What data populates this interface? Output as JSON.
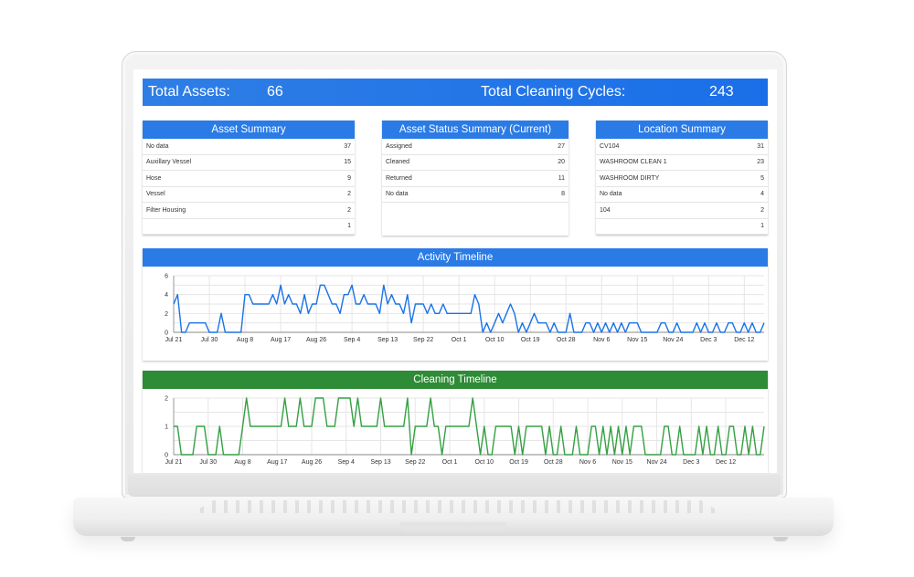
{
  "kpis": {
    "total_assets_label": "Total Assets:",
    "total_assets_value": "66",
    "total_cycles_label": "Total Cleaning Cycles:",
    "total_cycles_value": "243"
  },
  "panels": {
    "asset_summary": {
      "title": "Asset Summary",
      "rows": [
        {
          "label": "No data",
          "value": "37"
        },
        {
          "label": "Auxillary Vessel",
          "value": "15"
        },
        {
          "label": "Hose",
          "value": "9"
        },
        {
          "label": "Vessel",
          "value": "2"
        },
        {
          "label": "Filter Housing",
          "value": "2"
        },
        {
          "label": "",
          "value": "1"
        }
      ]
    },
    "asset_status_summary": {
      "title": "Asset Status Summary (Current)",
      "rows": [
        {
          "label": "Assigned",
          "value": "27"
        },
        {
          "label": "Cleaned",
          "value": "20"
        },
        {
          "label": "Returned",
          "value": "11"
        },
        {
          "label": "No data",
          "value": "8"
        }
      ]
    },
    "location_summary": {
      "title": "Location Summary",
      "rows": [
        {
          "label": "CV104",
          "value": "31"
        },
        {
          "label": "WASHROOM CLEAN 1",
          "value": "23"
        },
        {
          "label": "WASHROOM DIRTY",
          "value": "5"
        },
        {
          "label": "No data",
          "value": "4"
        },
        {
          "label": "104",
          "value": "2"
        },
        {
          "label": "",
          "value": "1"
        }
      ]
    }
  },
  "colors": {
    "header_blue": "#2b7be6",
    "header_green": "#2e8b36",
    "activity_line": "#1a73e8",
    "cleaning_line": "#34a043"
  },
  "chart_data": [
    {
      "type": "line",
      "title": "Activity Timeline",
      "xlabel": "",
      "ylabel": "",
      "x_start": "Jul 21",
      "x_step_days": 1,
      "tick_labels": [
        "Jul 21",
        "Jul 30",
        "Aug 8",
        "Aug 17",
        "Aug 26",
        "Sep 4",
        "Sep 13",
        "Sep 22",
        "Oct 1",
        "Oct 10",
        "Oct 19",
        "Oct 28",
        "Nov 6",
        "Nov 15",
        "Nov 24",
        "Dec 3",
        "Dec 12"
      ],
      "tick_every_days": 9,
      "y_ticks": [
        0,
        2,
        4,
        6
      ],
      "ylim": [
        0,
        6
      ],
      "grid": true,
      "legend": "none",
      "series": [
        {
          "name": "Activity",
          "values": [
            3,
            4,
            0,
            0,
            1,
            1,
            1,
            1,
            1,
            0,
            0,
            0,
            2,
            0,
            0,
            0,
            0,
            0,
            4,
            4,
            3,
            3,
            3,
            3,
            3,
            4,
            3,
            5,
            3,
            4,
            3,
            3,
            2,
            4,
            2,
            3,
            3,
            5,
            5,
            4,
            3,
            3,
            2,
            4,
            4,
            5,
            3,
            3,
            4,
            3,
            3,
            3,
            2,
            5,
            3,
            4,
            3,
            3,
            2,
            4,
            1,
            3,
            3,
            3,
            2,
            3,
            2,
            2,
            3,
            2,
            2,
            2,
            2,
            2,
            2,
            2,
            4,
            3,
            0,
            1,
            0,
            1,
            2,
            1,
            2,
            3,
            2,
            0,
            1,
            0,
            1,
            2,
            1,
            1,
            1,
            0,
            1,
            0,
            0,
            0,
            2,
            0,
            0,
            0,
            1,
            1,
            0,
            1,
            0,
            1,
            0,
            1,
            0,
            1,
            0,
            1,
            1,
            1,
            0,
            0,
            0,
            0,
            0,
            1,
            1,
            0,
            0,
            1,
            0,
            0,
            0,
            0,
            1,
            0,
            1,
            0,
            0,
            1,
            0,
            0,
            1,
            1,
            0,
            0,
            1,
            0,
            1,
            0,
            0,
            1
          ]
        }
      ]
    },
    {
      "type": "line",
      "title": "Cleaning Timeline",
      "xlabel": "",
      "ylabel": "",
      "x_start": "Jul 21",
      "x_step_days": 1,
      "tick_labels": [
        "Jul 21",
        "Jul 30",
        "Aug 8",
        "Aug 17",
        "Aug 26",
        "Sep 4",
        "Sep 13",
        "Sep 22",
        "Oct 1",
        "Oct 10",
        "Oct 19",
        "Oct 28",
        "Nov 6",
        "Nov 15",
        "Nov 24",
        "Dec 3",
        "Dec 12"
      ],
      "tick_every_days": 9,
      "y_ticks": [
        0,
        1,
        2
      ],
      "ylim": [
        0,
        2
      ],
      "grid": true,
      "legend": "none",
      "series": [
        {
          "name": "Cleaning",
          "values": [
            1,
            1,
            0,
            0,
            0,
            0,
            1,
            1,
            1,
            0,
            0,
            0,
            1,
            0,
            0,
            0,
            0,
            0,
            1,
            2,
            1,
            1,
            1,
            1,
            1,
            1,
            1,
            1,
            1,
            2,
            1,
            1,
            1,
            2,
            1,
            1,
            1,
            2,
            2,
            2,
            1,
            1,
            1,
            2,
            2,
            2,
            2,
            1,
            2,
            1,
            1,
            1,
            1,
            1,
            2,
            1,
            1,
            1,
            1,
            1,
            1,
            2,
            0,
            1,
            1,
            1,
            1,
            2,
            1,
            1,
            0,
            1,
            1,
            1,
            1,
            1,
            1,
            1,
            2,
            1,
            0,
            1,
            0,
            0,
            1,
            1,
            1,
            1,
            1,
            0,
            1,
            0,
            1,
            1,
            1,
            1,
            1,
            0,
            1,
            0,
            0,
            1,
            0,
            0,
            0,
            1,
            0,
            0,
            0,
            1,
            1,
            0,
            1,
            0,
            1,
            0,
            1,
            0,
            1,
            0,
            1,
            1,
            1,
            0,
            0,
            0,
            0,
            0,
            1,
            1,
            0,
            0,
            1,
            0,
            0,
            0,
            0,
            1,
            0,
            1,
            0,
            0,
            1,
            0,
            0,
            1,
            1,
            0,
            0,
            1,
            0,
            1,
            0,
            0,
            1
          ]
        }
      ]
    }
  ]
}
